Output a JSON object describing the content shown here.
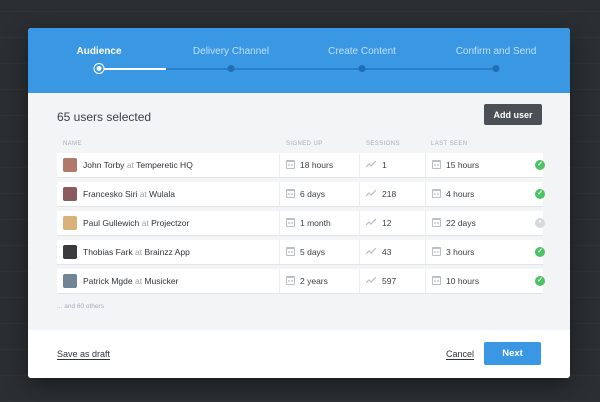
{
  "stepper": {
    "steps": [
      {
        "label": "Audience",
        "active": true
      },
      {
        "label": "Delivery Channel",
        "active": false
      },
      {
        "label": "Create Content",
        "active": false
      },
      {
        "label": "Confirm and Send",
        "active": false
      }
    ]
  },
  "audience": {
    "selected_title": "65 users selected",
    "add_user_label": "Add user",
    "columns": [
      "NAME",
      "SIGNED UP",
      "SESSIONS",
      "LAST SEEN"
    ],
    "rows": [
      {
        "name": "John Torby",
        "at": "at",
        "company": "Temperetic HQ",
        "signed_up": "18 hours",
        "sessions": "1",
        "last_seen": "15 hours",
        "status": "active",
        "avatar_color": "#b07a6a"
      },
      {
        "name": "Francesko Siri",
        "at": "at",
        "company": "Wulala",
        "signed_up": "6 days",
        "sessions": "218",
        "last_seen": "4 hours",
        "status": "active",
        "avatar_color": "#8a5a5c"
      },
      {
        "name": "Paul Gullewich",
        "at": "at",
        "company": "Projectzor",
        "signed_up": "1 month",
        "sessions": "12",
        "last_seen": "22 days",
        "status": "inactive",
        "avatar_color": "#d9b27a"
      },
      {
        "name": "Thobias Fark",
        "at": "at",
        "company": "Brainzz App",
        "signed_up": "5 days",
        "sessions": "43",
        "last_seen": "3 hours",
        "status": "active",
        "avatar_color": "#3b3b3d"
      },
      {
        "name": "Patrick Mgde",
        "at": "at",
        "company": "Musicker",
        "signed_up": "2 years",
        "sessions": "597",
        "last_seen": "10 hours",
        "status": "active",
        "avatar_color": "#6f8596"
      }
    ],
    "others_text": "... and 60 others"
  },
  "footer": {
    "save_draft_label": "Save as draft",
    "cancel_label": "Cancel",
    "next_label": "Next"
  },
  "colors": {
    "accent": "#3a97e4",
    "status_ok": "#4cc265",
    "status_inactive": "#d5d9dd"
  }
}
